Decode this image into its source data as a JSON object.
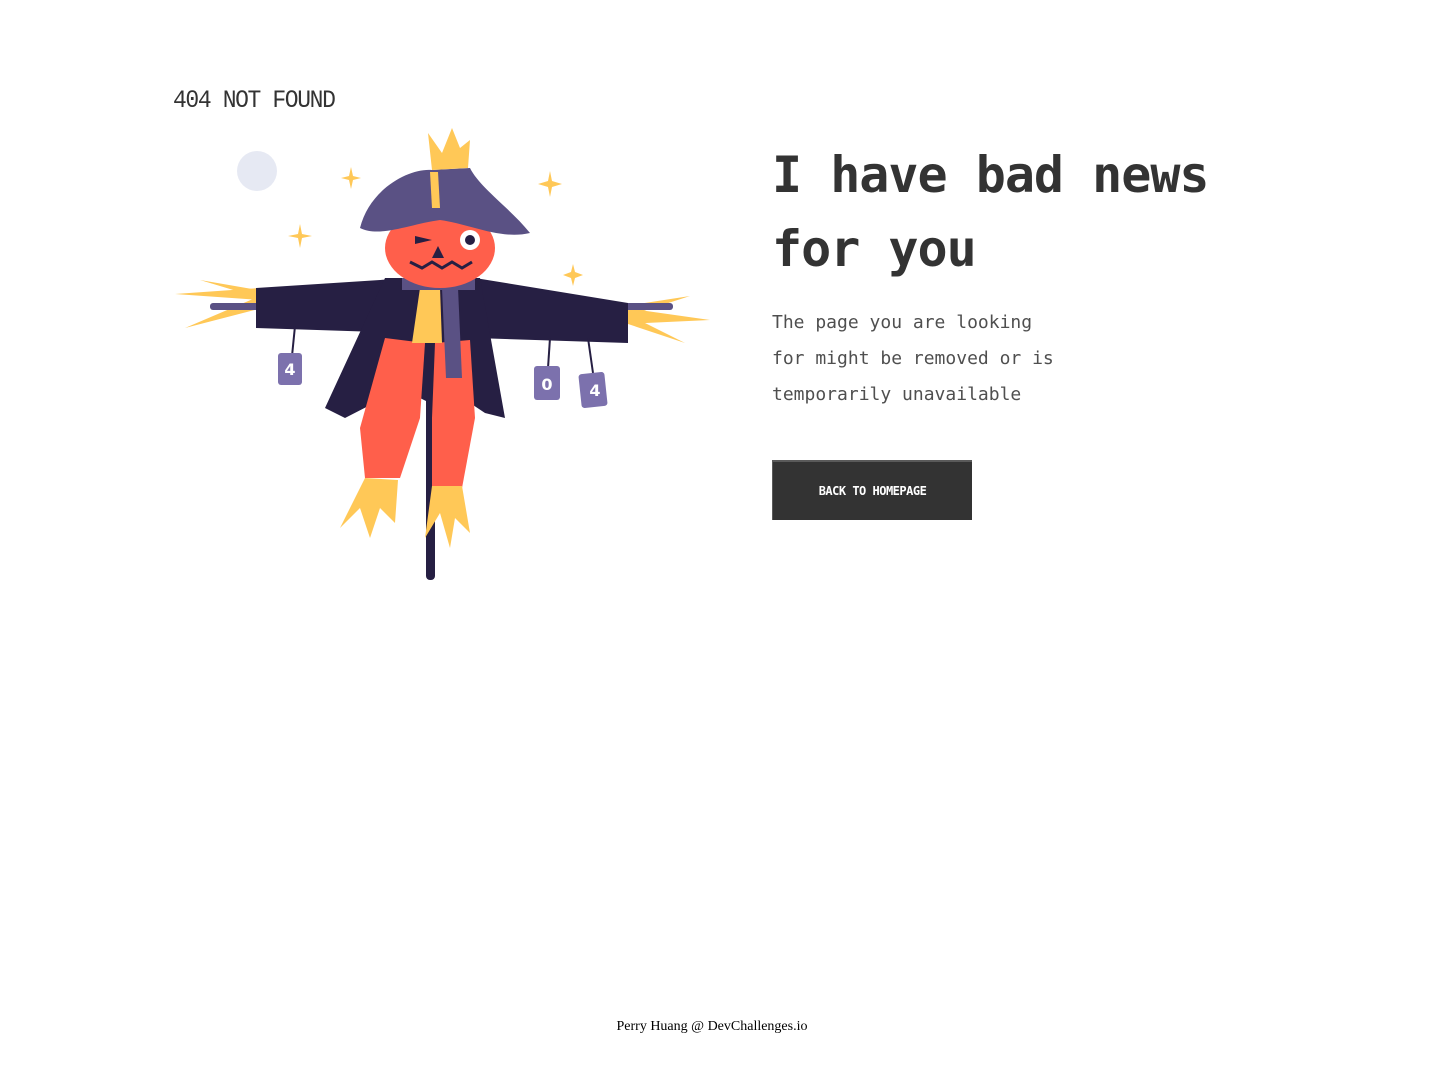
{
  "header": {
    "brand": "404 NOT FOUND"
  },
  "illustration": {
    "label": "scarecrow-illustration",
    "can_labels": [
      "4",
      "0",
      "4"
    ]
  },
  "main": {
    "headline_line1": "I have bad news",
    "headline_line2": "for you",
    "subtext_line1": "The page you are looking",
    "subtext_line2": "for might be removed or is",
    "subtext_line3": "temporarily unavailable",
    "cta_label": "BACK TO HOMEPAGE"
  },
  "footer": {
    "author": "Perry Huang",
    "separator": "@",
    "site": "DevChallenges.io"
  },
  "colors": {
    "text": "#333333",
    "button_bg": "#333333",
    "button_text": "#ffffff",
    "hat": "#5a5184",
    "coat": "#261f43",
    "pumpkin": "#ff5f4b",
    "straw": "#ffc857",
    "moon": "#e6e9f3"
  }
}
